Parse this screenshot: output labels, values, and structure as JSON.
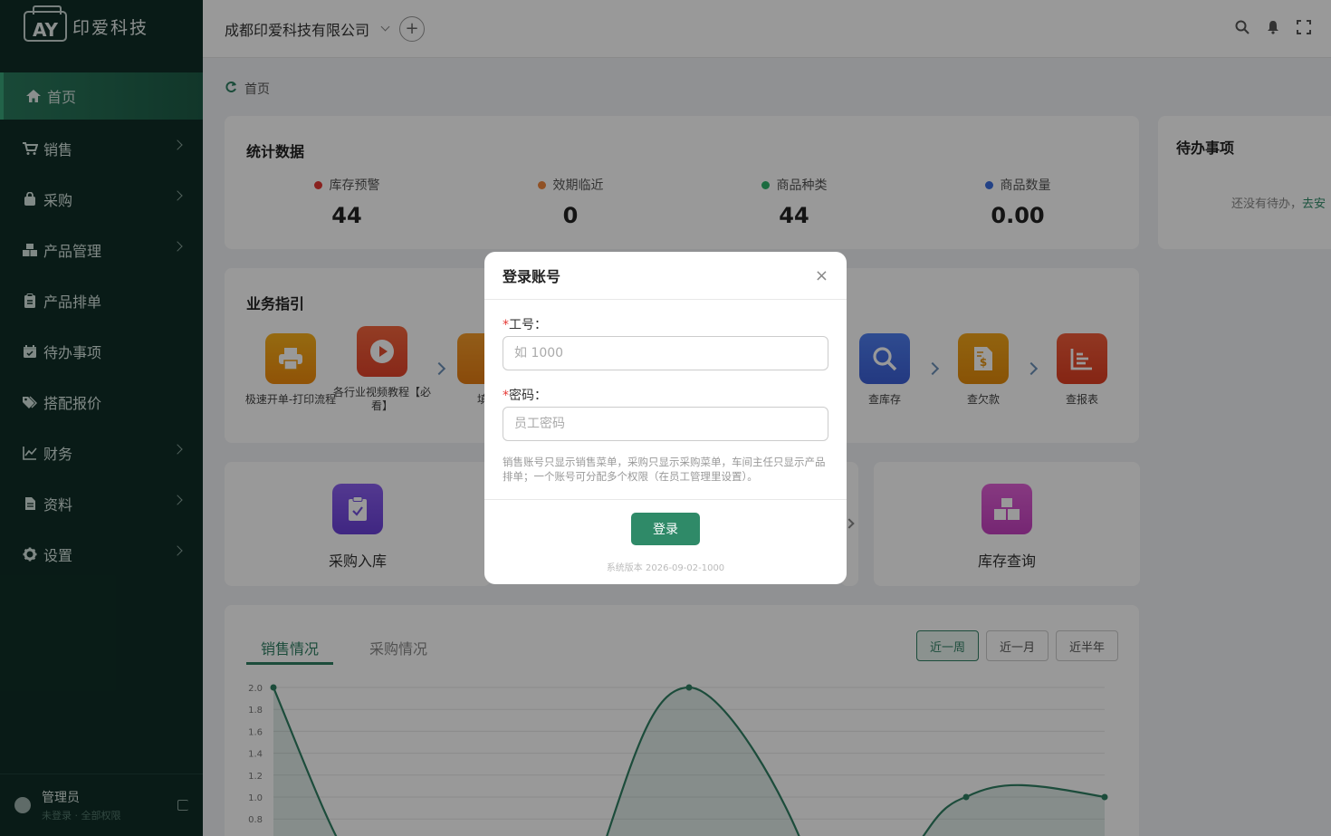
{
  "app": {
    "logo_mark": "AY",
    "logo_text": "印爱科技"
  },
  "sidebar": {
    "items": [
      {
        "label": "首页",
        "icon": "home-icon",
        "active": true
      },
      {
        "label": "销售",
        "icon": "cart-icon"
      },
      {
        "label": "采购",
        "icon": "bag-icon"
      },
      {
        "label": "产品管理",
        "icon": "boxes-icon"
      },
      {
        "label": "产品排单",
        "icon": "clipboard-icon"
      },
      {
        "label": "待办事项",
        "icon": "calendar-icon"
      },
      {
        "label": "搭配报价",
        "icon": "tag-icon"
      },
      {
        "label": "财务",
        "icon": "line-chart-icon"
      },
      {
        "label": "资料",
        "icon": "file-icon"
      },
      {
        "label": "设置",
        "icon": "gear-icon"
      }
    ],
    "user": {
      "name": "管理员",
      "status": "未登录 · 全部权限"
    }
  },
  "topbar": {
    "company": "成都印爱科技有限公司"
  },
  "breadcrumb": {
    "label": "首页"
  },
  "stats": {
    "title": "统计数据",
    "items": [
      {
        "label": "库存预警",
        "value": "44",
        "color": "#e53935"
      },
      {
        "label": "效期临近",
        "value": "0",
        "color": "#f0883e"
      },
      {
        "label": "商品种类",
        "value": "44",
        "color": "#2fb36b"
      },
      {
        "label": "商品数量",
        "value": "0.00",
        "color": "#3b6fe0"
      }
    ]
  },
  "todo": {
    "title": "待办事项",
    "empty": "还没有待办，",
    "link": "去安"
  },
  "guide": {
    "title": "业务指引",
    "items": [
      {
        "label": "极速开单-打印流程",
        "icon": "printer-icon"
      },
      {
        "label": "各行业视频教程【必看】",
        "icon": "play-icon"
      },
      {
        "label": "填",
        "icon": "doc-icon"
      },
      {
        "label": "查库存",
        "icon": "search-icon"
      },
      {
        "label": "查欠款",
        "icon": "invoice-icon"
      },
      {
        "label": "查报表",
        "icon": "report-icon"
      }
    ]
  },
  "quick": {
    "items": [
      {
        "label": "采购入库",
        "icon": "clipboard-check-icon"
      },
      {
        "label": "库存查询",
        "icon": "boxes-icon"
      }
    ]
  },
  "trend": {
    "tabs": [
      "销售情况",
      "采购情况"
    ],
    "ranges": [
      "近一周",
      "近一月",
      "近半年"
    ],
    "selected_range": "近一周"
  },
  "chart_data": {
    "type": "area",
    "title": "",
    "yticks": [
      "2.0",
      "1.8",
      "1.6",
      "1.4",
      "1.2",
      "1.0",
      "0.8"
    ],
    "ylim": [
      0.8,
      2.0
    ],
    "points": [
      {
        "x": 0,
        "y": 2.0
      },
      {
        "x": 3,
        "y": 2.0
      },
      {
        "x": 5,
        "y": 1.0
      },
      {
        "x": 6,
        "y": 1.0
      }
    ]
  },
  "modal": {
    "title": "登录账号",
    "close": "×",
    "fields": [
      {
        "label": "工号：",
        "placeholder": "如 1000"
      },
      {
        "label": "密码：",
        "placeholder": "员工密码"
      }
    ],
    "hint": "销售账号只显示销售菜单，采购只显示采购菜单，车间主任只显示产品排单；一个账号可分配多个权限（在员工管理里设置）。",
    "submit": "登录",
    "version": "系统版本 2026-09-02-1000"
  }
}
